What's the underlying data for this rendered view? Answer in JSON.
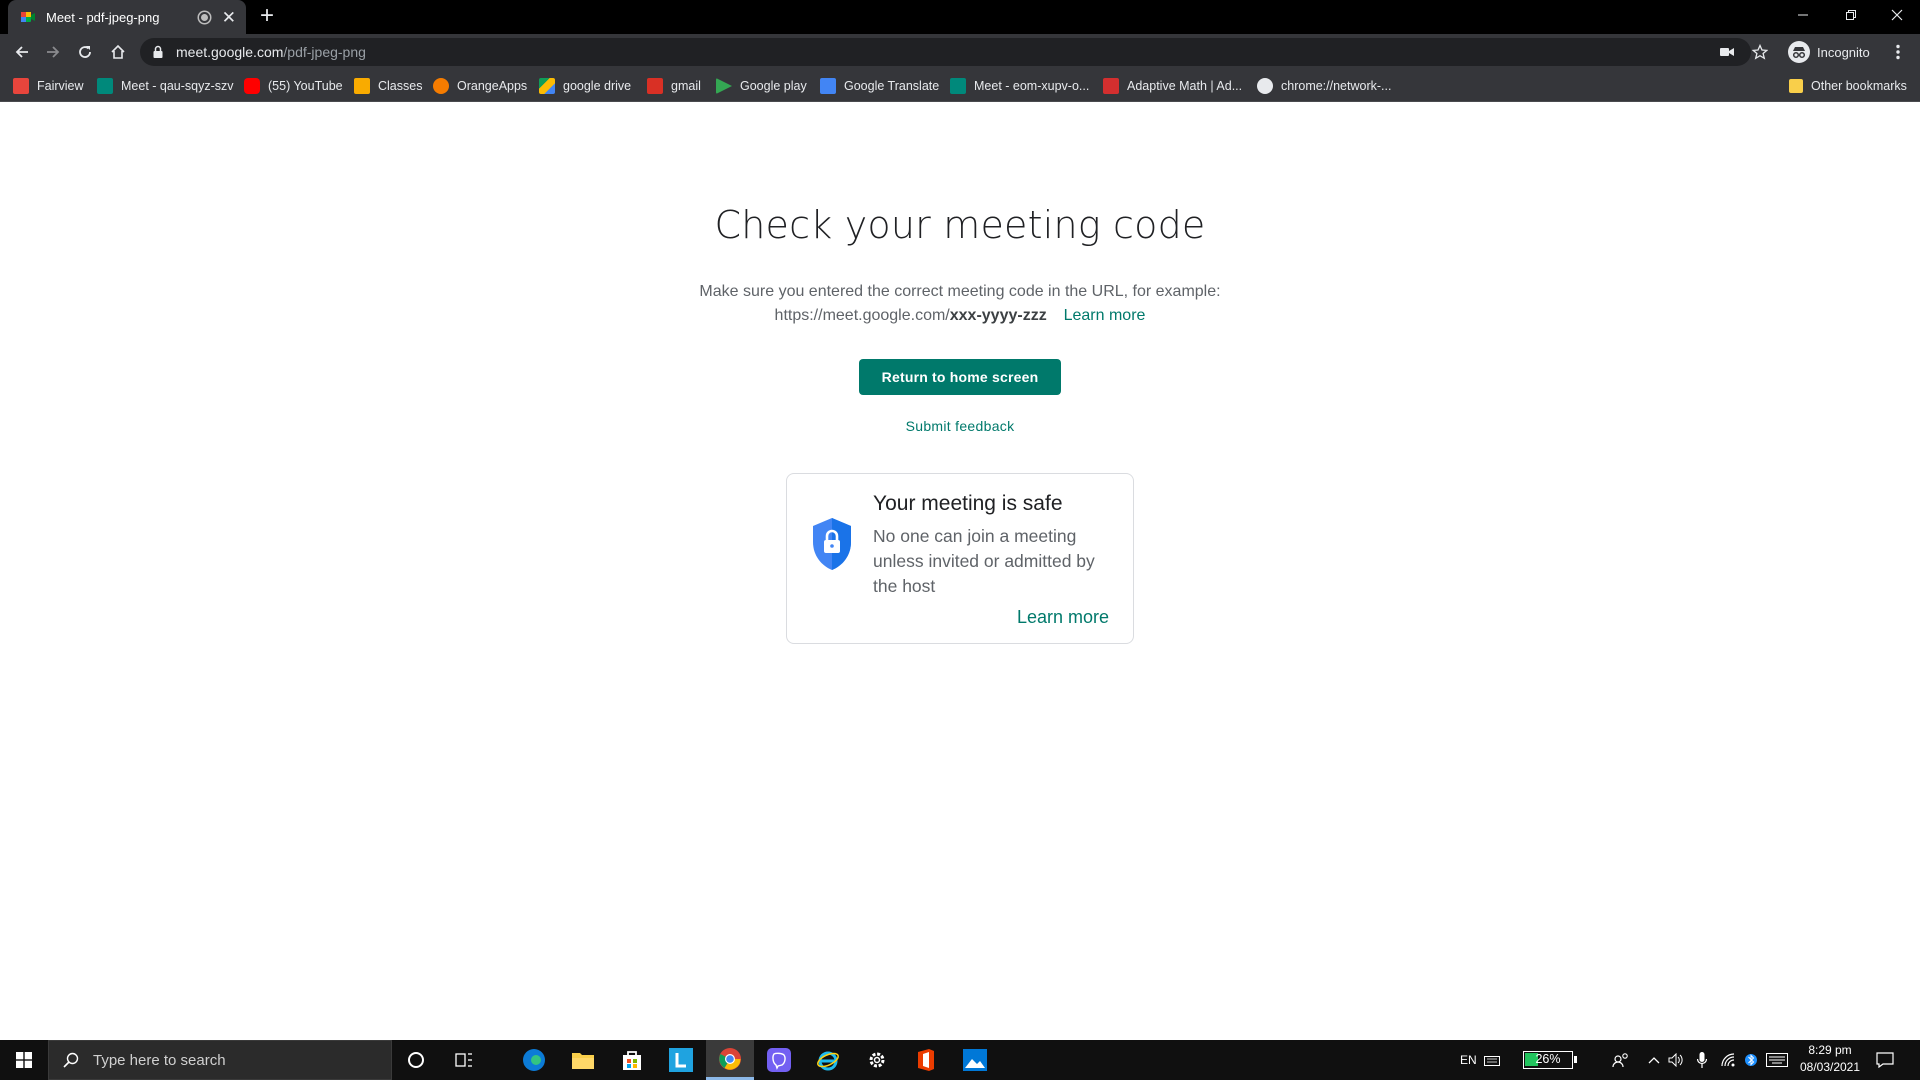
{
  "browser": {
    "tab_title": "Meet - pdf-jpeg-png",
    "new_tab": "+",
    "url_host": "meet.google.com",
    "url_path": "/pdf-jpeg-png",
    "profile_label": "Incognito",
    "bookmarks": [
      {
        "label": "Fairview",
        "icon": "fairview-icon",
        "color": "#e8453c"
      },
      {
        "label": "Meet - qau-sqyz-szv",
        "icon": "meet-icon",
        "color": "#00897b"
      },
      {
        "label": "(55) YouTube",
        "icon": "youtube-icon",
        "color": "#ff0000"
      },
      {
        "label": "Classes",
        "icon": "classroom-icon",
        "color": "#f9ab00"
      },
      {
        "label": "OrangeApps",
        "icon": "orangeapps-icon",
        "color": "#f57c00"
      },
      {
        "label": "google drive",
        "icon": "drive-icon",
        "color": "#1e88e5"
      },
      {
        "label": "gmail",
        "icon": "gmail-icon",
        "color": "#d93025"
      },
      {
        "label": "Google play",
        "icon": "play-icon",
        "color": "#34a853"
      },
      {
        "label": "Google Translate",
        "icon": "translate-icon",
        "color": "#4285f4"
      },
      {
        "label": "Meet - eom-xupv-o...",
        "icon": "meet-icon",
        "color": "#00897b"
      },
      {
        "label": "Adaptive Math | Ad...",
        "icon": "adaptive-math-icon",
        "color": "#d32f2f"
      },
      {
        "label": "chrome://network-...",
        "icon": "globe-icon",
        "color": "#e8eaed"
      }
    ],
    "other_bookmarks": "Other bookmarks"
  },
  "page": {
    "title": "Check your meeting code",
    "desc_line1": "Make sure you entered the correct meeting code in the URL, for example:",
    "desc_url_prefix": "https://meet.google.com/",
    "desc_url_code": "xxx-yyyy-zzz",
    "desc_learn_more": "Learn more",
    "primary_button": "Return to home screen",
    "feedback_link": "Submit feedback",
    "card": {
      "title": "Your meeting is safe",
      "body": "No one can join a meeting unless invited or admitted by the host",
      "learn_more": "Learn more"
    }
  },
  "taskbar": {
    "search_placeholder": "Type here to search",
    "language": "EN",
    "battery": "26%",
    "time": "8:29 pm",
    "date": "08/03/2021"
  },
  "colors": {
    "accent": "#00796b",
    "shield": "#4285f4"
  }
}
